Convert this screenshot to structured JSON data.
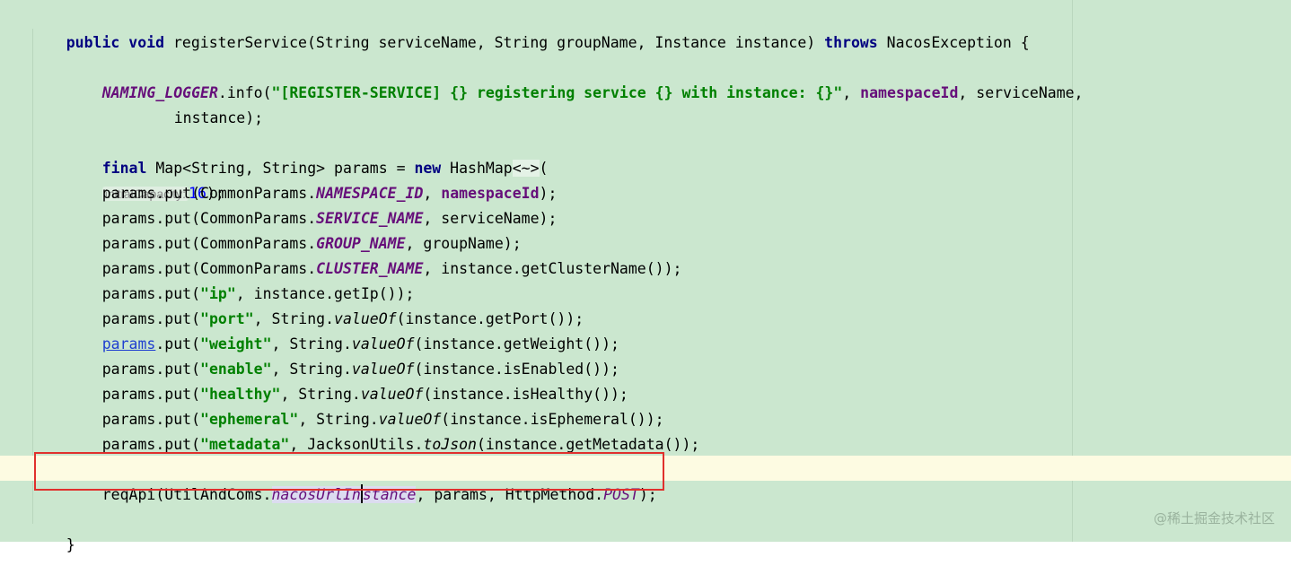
{
  "lines": {
    "l1": {
      "kw1": "public void",
      "text": " registerService(String serviceName, String groupName, Instance instance) ",
      "kw2": "throws",
      "tail": " NacosException {"
    },
    "l2": {
      "logger": "NAMING_LOGGER",
      "call": ".info(",
      "str": "\"[REGISTER-SERVICE] {} registering service {} with instance: {}\"",
      "sep": ", ",
      "field": "namespaceId",
      "tail": ", serviceName,"
    },
    "l3": {
      "text": "instance);"
    },
    "l4": {
      "kw1": "final",
      "mid": " Map<String, String> params = ",
      "kw2": "new",
      "type": " HashMap",
      "diamond": "<~>",
      "open": "(",
      "hint": "initialCapacity:",
      "num": "16",
      "close": ");"
    },
    "l5": {
      "pre": "params.put(CommonParams.",
      "const": "NAMESPACE_ID",
      "sep": ", ",
      "field": "namespaceId",
      "tail": ");"
    },
    "l6": {
      "pre": "params.put(CommonParams.",
      "const": "SERVICE_NAME",
      "tail": ", serviceName);"
    },
    "l7": {
      "pre": "params.put(CommonParams.",
      "const": "GROUP_NAME",
      "tail": ", groupName);"
    },
    "l8": {
      "pre": "params.put(CommonParams.",
      "const": "CLUSTER_NAME",
      "tail": ", instance.getClusterName());"
    },
    "l9": {
      "pre": "params.put(",
      "str": "\"ip\"",
      "tail": ", instance.getIp());"
    },
    "l10": {
      "pre": "params.put(",
      "str": "\"port\"",
      "mid": ", String.",
      "method": "valueOf",
      "tail": "(instance.getPort());"
    },
    "l11": {
      "link": "params",
      "pre": ".put(",
      "str": "\"weight\"",
      "mid": ", String.",
      "method": "valueOf",
      "tail": "(instance.getWeight());"
    },
    "l12": {
      "pre": "params.put(",
      "str": "\"enable\"",
      "mid": ", String.",
      "method": "valueOf",
      "tail": "(instance.isEnabled());"
    },
    "l13": {
      "pre": "params.put(",
      "str": "\"healthy\"",
      "mid": ", String.",
      "method": "valueOf",
      "tail": "(instance.isHealthy());"
    },
    "l14": {
      "pre": "params.put(",
      "str": "\"ephemeral\"",
      "mid": ", String.",
      "method": "valueOf",
      "tail": "(instance.isEphemeral());"
    },
    "l15": {
      "pre": "params.put(",
      "str": "\"metadata\"",
      "mid": ", JacksonUtils.",
      "method": "toJson",
      "tail": "(instance.getMetadata());"
    },
    "l16": {
      "pre": "reqApi(UtilAndComs.",
      "sel_a": "nacosUrlIn",
      "sel_b": "stance",
      "mid": ", params, HttpMethod.",
      "const": "POST",
      "tail": ");"
    },
    "l17": {
      "text": "}"
    }
  },
  "watermark": "@稀土掘金技术社区",
  "colors": {
    "background": "#cbe7cf",
    "caret_line": "#fdfbe2",
    "highlight_box": "#e0302c"
  }
}
